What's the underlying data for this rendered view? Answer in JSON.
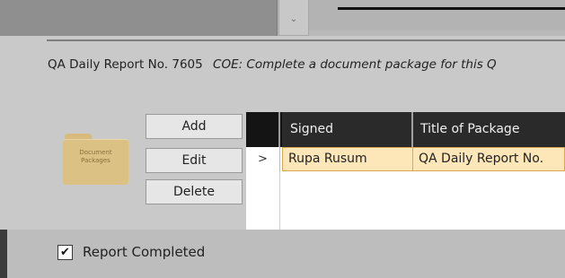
{
  "report": {
    "title": "QA Daily Report No. 7605",
    "description": "COE: Complete a document package for this Q"
  },
  "folder": {
    "label_line1": "Document",
    "label_line2": "Packages"
  },
  "buttons": {
    "add": "Add",
    "edit": "Edit",
    "delete": "Delete"
  },
  "grid": {
    "columns": [
      "Signed",
      "Title of Package"
    ],
    "rows": [
      {
        "indicator": ">",
        "signed": "Rupa Rusum",
        "title": "QA Daily Report No."
      }
    ]
  },
  "footer": {
    "report_completed_label": "Report Completed",
    "report_completed_checked": true,
    "checkmark": "✔"
  },
  "combo": {
    "arrow": "⌄"
  }
}
